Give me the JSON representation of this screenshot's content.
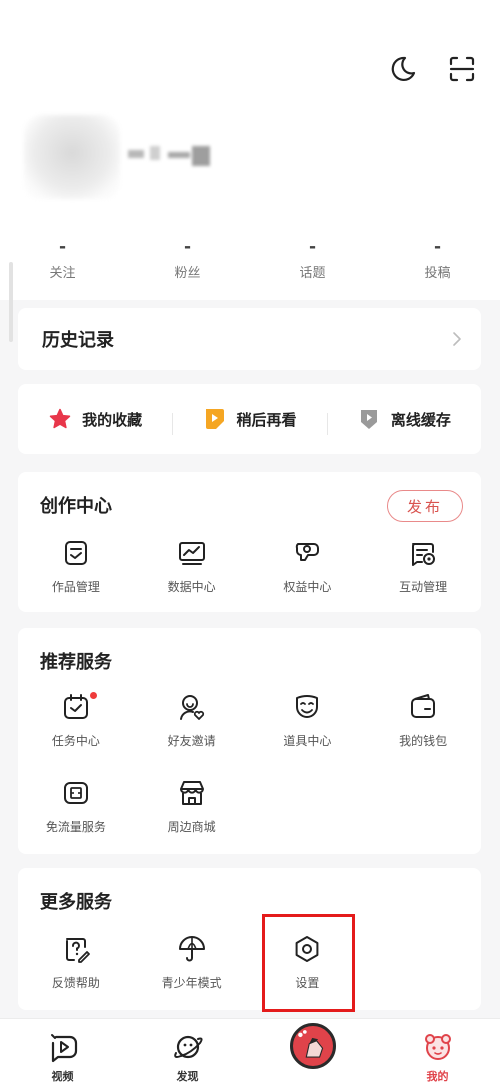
{
  "header": {
    "moon_icon": "moon-icon",
    "scan_icon": "scan-icon"
  },
  "stats": [
    {
      "value": "-",
      "label": "关注"
    },
    {
      "value": "-",
      "label": "粉丝"
    },
    {
      "value": "-",
      "label": "话题"
    },
    {
      "value": "-",
      "label": "投稿"
    }
  ],
  "history": {
    "title": "历史记录"
  },
  "quick": [
    {
      "label": "我的收藏",
      "icon": "star-icon",
      "color": "#e8364a"
    },
    {
      "label": "稍后再看",
      "icon": "play-later-icon",
      "color": "#f5a623"
    },
    {
      "label": "离线缓存",
      "icon": "download-icon",
      "color": "#9a9a9a"
    }
  ],
  "create": {
    "title": "创作中心",
    "publish": "发布",
    "items": [
      {
        "label": "作品管理",
        "icon": "works-icon"
      },
      {
        "label": "数据中心",
        "icon": "data-chart-icon"
      },
      {
        "label": "权益中心",
        "icon": "rights-icon"
      },
      {
        "label": "互动管理",
        "icon": "interaction-icon"
      }
    ]
  },
  "recommend": {
    "title": "推荐服务",
    "items": [
      {
        "label": "任务中心",
        "icon": "calendar-task-icon"
      },
      {
        "label": "好友邀请",
        "icon": "invite-friend-icon"
      },
      {
        "label": "道具中心",
        "icon": "mask-icon"
      },
      {
        "label": "我的钱包",
        "icon": "wallet-icon"
      },
      {
        "label": "免流量服务",
        "icon": "sim-card-icon"
      },
      {
        "label": "周边商城",
        "icon": "shop-icon"
      }
    ]
  },
  "more": {
    "title": "更多服务",
    "items": [
      {
        "label": "反馈帮助",
        "icon": "feedback-icon"
      },
      {
        "label": "青少年模式",
        "icon": "umbrella-icon"
      },
      {
        "label": "设置",
        "icon": "settings-icon"
      }
    ]
  },
  "tabbar": [
    {
      "label": "视频",
      "icon": "video-tab-icon"
    },
    {
      "label": "发现",
      "icon": "planet-tab-icon"
    },
    {
      "label": "",
      "icon": "center-avatar-icon"
    },
    {
      "label": "我的",
      "icon": "mine-tab-icon",
      "active": true
    }
  ],
  "colors": {
    "accent": "#e0434a",
    "highlight": "#e41b1b"
  }
}
